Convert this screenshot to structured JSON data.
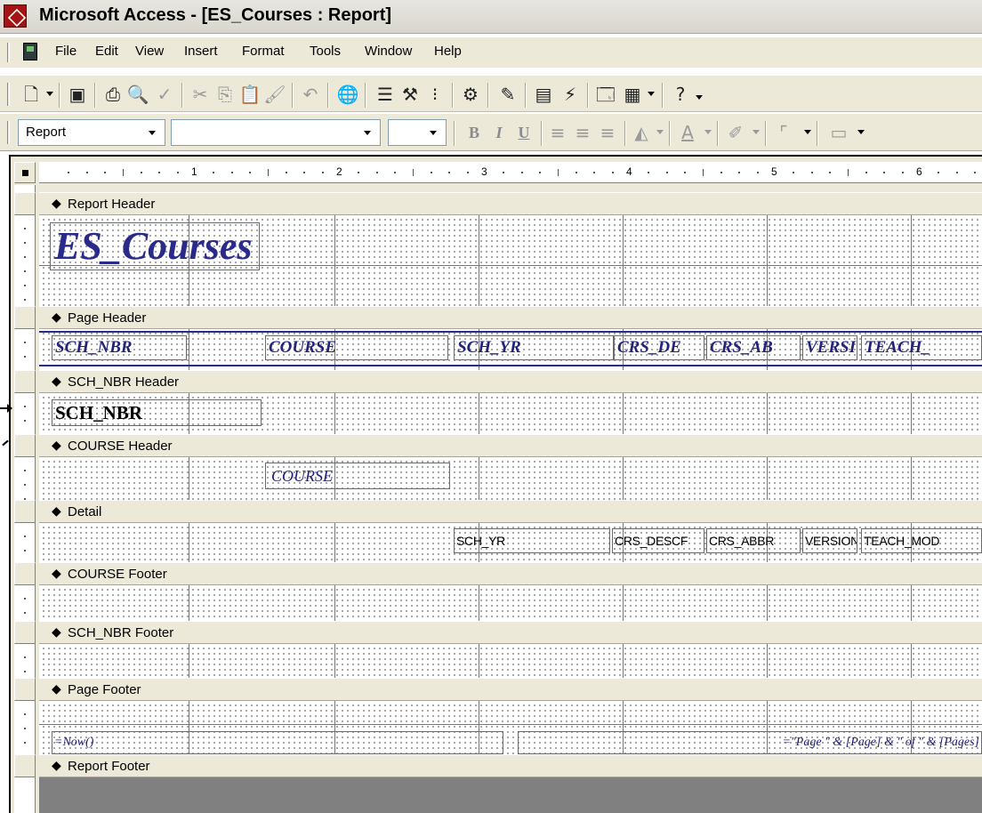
{
  "window": {
    "title": "Microsoft Access - [ES_Courses : Report]"
  },
  "menu": [
    "File",
    "Edit",
    "View",
    "Insert",
    "Format",
    "Tools",
    "Window",
    "Help"
  ],
  "toolbar1_icons": [
    "view-icon",
    "save-icon",
    "print-icon",
    "print-preview-icon",
    "spelling-icon",
    "cut-icon",
    "copy-icon",
    "paste-icon",
    "format-painter-icon",
    "undo-icon",
    "insert-hyperlink-icon",
    "field-list-icon",
    "toolbox-icon",
    "sorting-grouping-icon",
    "autoformat-icon",
    "code-icon",
    "properties-icon",
    "build-icon",
    "database-window-icon",
    "new-object-icon",
    "help-icon"
  ],
  "formatting": {
    "object_combo": "Report",
    "font_combo": "",
    "size_combo": "",
    "buttons": {
      "bold": "B",
      "italic": "I",
      "underline": "U"
    }
  },
  "ruler": {
    "numbers": [
      "1",
      "2",
      "3",
      "4",
      "5",
      "6"
    ]
  },
  "sections": [
    {
      "label": "Report Header"
    },
    {
      "label": "Page Header"
    },
    {
      "label": "SCH_NBR Header"
    },
    {
      "label": "COURSE Header"
    },
    {
      "label": "Detail"
    },
    {
      "label": "COURSE Footer"
    },
    {
      "label": "SCH_NBR Footer"
    },
    {
      "label": "Page Footer"
    },
    {
      "label": "Report Footer"
    }
  ],
  "controls": {
    "report_title": "ES_Courses",
    "page_header": [
      "SCH_NBR",
      "COURSE",
      "SCH_YR",
      "CRS_DE",
      "CRS_AB",
      "VERSI",
      "TEACH_"
    ],
    "sch_nbr_header": "SCH_NBR",
    "course_header": "COURSE",
    "detail": [
      "SCH_YR",
      "CRS_DESCF",
      "CRS_ABBR",
      "VERSION",
      "TEACH_MOD"
    ],
    "page_footer_left": "=Now()",
    "page_footer_right": "=\"Page \" & [Page] & \" of \" & [Pages]"
  }
}
